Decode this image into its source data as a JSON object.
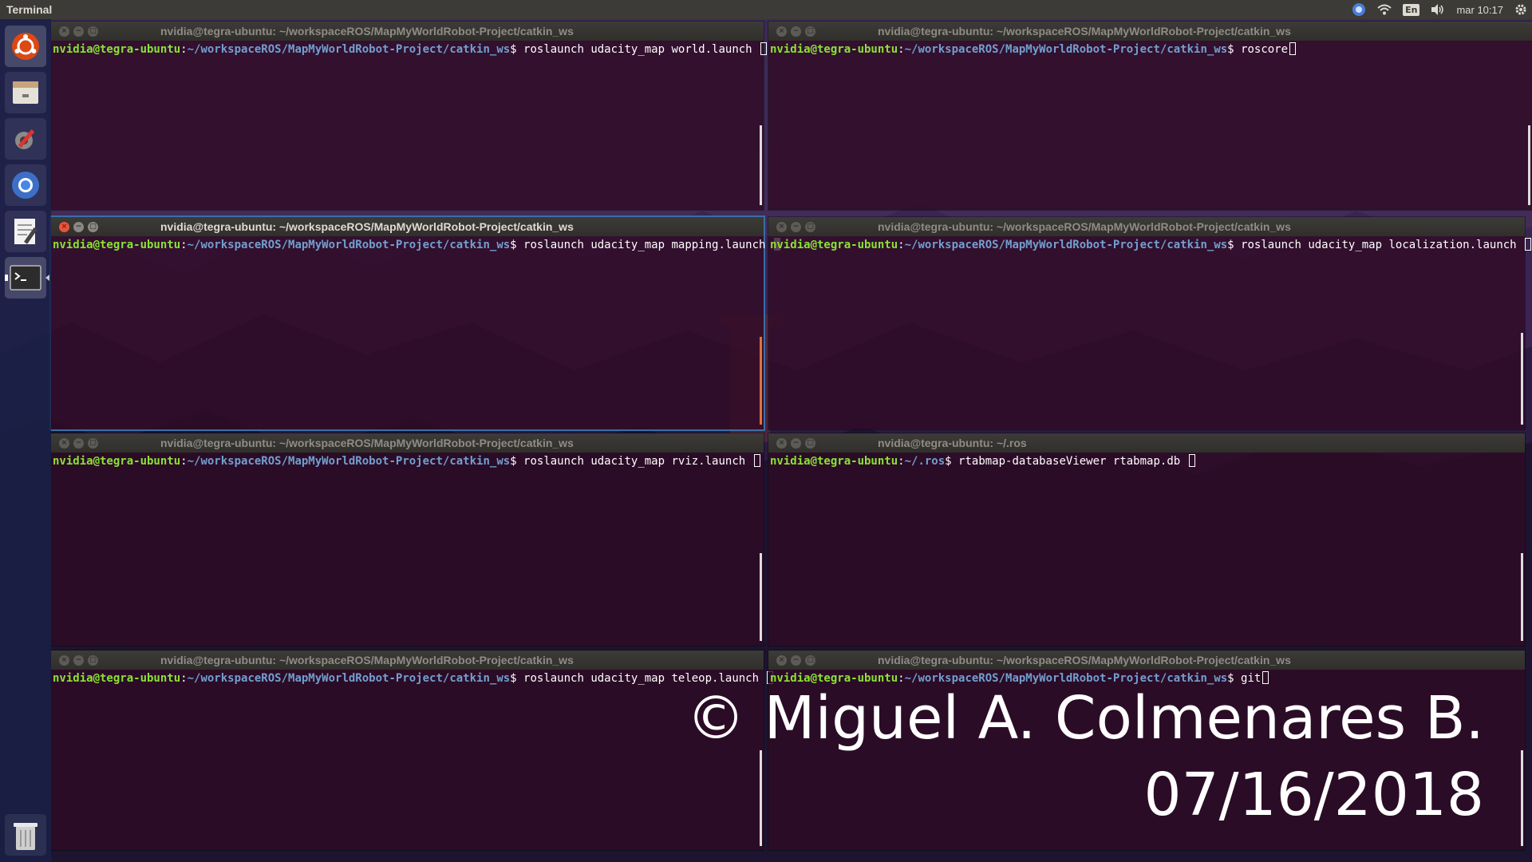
{
  "panel": {
    "app_title": "Terminal",
    "keyboard_layout": "En",
    "clock": "mar 10:17",
    "indicator_icons": [
      "chromium-icon",
      "wifi-icon",
      "keyboard-icon",
      "volume-icon",
      "gear-icon"
    ]
  },
  "launcher": {
    "items": [
      "ubuntu-logo-icon",
      "files-icon",
      "system-settings-icon",
      "chromium-icon",
      "text-editor-icon",
      "terminal-icon",
      "trash-icon"
    ]
  },
  "terminals": [
    {
      "title": "nvidia@tegra-ubuntu: ~/workspaceROS/MapMyWorldRobot-Project/catkin_ws",
      "user": "nvidia@tegra-ubuntu",
      "path": "~/workspaceROS/MapMyWorldRobot-Project/catkin_ws",
      "command": "roslaunch udacity_map world.launch "
    },
    {
      "title": "nvidia@tegra-ubuntu: ~/workspaceROS/MapMyWorldRobot-Project/catkin_ws",
      "user": "nvidia@tegra-ubuntu",
      "path": "~/workspaceROS/MapMyWorldRobot-Project/catkin_ws",
      "command": "roscore"
    },
    {
      "title": "nvidia@tegra-ubuntu: ~/workspaceROS/MapMyWorldRobot-Project/catkin_ws",
      "user": "nvidia@tegra-ubuntu",
      "path": "~/workspaceROS/MapMyWorldRobot-Project/catkin_ws",
      "command": "roslaunch udacity_map mapping.launch "
    },
    {
      "title": "nvidia@tegra-ubuntu: ~/workspaceROS/MapMyWorldRobot-Project/catkin_ws",
      "user": "nvidia@tegra-ubuntu",
      "path": "~/workspaceROS/MapMyWorldRobot-Project/catkin_ws",
      "command": "roslaunch udacity_map localization.launch "
    },
    {
      "title": "nvidia@tegra-ubuntu: ~/workspaceROS/MapMyWorldRobot-Project/catkin_ws",
      "user": "nvidia@tegra-ubuntu",
      "path": "~/workspaceROS/MapMyWorldRobot-Project/catkin_ws",
      "command": "roslaunch udacity_map rviz.launch "
    },
    {
      "title": "nvidia@tegra-ubuntu: ~/.ros",
      "user": "nvidia@tegra-ubuntu",
      "path": "~/.ros",
      "command": "rtabmap-databaseViewer rtabmap.db "
    },
    {
      "title": "nvidia@tegra-ubuntu: ~/workspaceROS/MapMyWorldRobot-Project/catkin_ws",
      "user": "nvidia@tegra-ubuntu",
      "path": "~/workspaceROS/MapMyWorldRobot-Project/catkin_ws",
      "command": "roslaunch udacity_map teleop.launch "
    },
    {
      "title": "nvidia@tegra-ubuntu: ~/workspaceROS/MapMyWorldRobot-Project/catkin_ws",
      "user": "nvidia@tegra-ubuntu",
      "path": "~/workspaceROS/MapMyWorldRobot-Project/catkin_ws",
      "command": "git"
    }
  ],
  "prompt_sep": ":",
  "prompt_end": "$ ",
  "watermark": {
    "line1": "© Miguel A. Colmenares B.",
    "line2": "07/16/2018"
  },
  "colors": {
    "prompt_user": "#8ae234",
    "prompt_path": "#729fcf",
    "terminal_bg": "#300a24",
    "close_button": "#e8543c"
  }
}
